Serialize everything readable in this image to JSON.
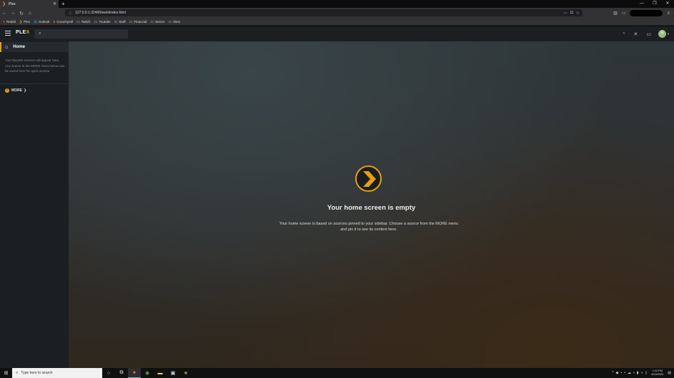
{
  "browser": {
    "tab_title": "Plex",
    "url": "127.0.0.1:32400/web/index.html",
    "bookmarks": [
      {
        "label": "Reddit",
        "icon": "reddit-icon"
      },
      {
        "label": "Plex",
        "icon": "plex-icon"
      },
      {
        "label": "Outlook",
        "icon": "outlook-icon"
      },
      {
        "label": "Crunchyroll",
        "icon": "crunchyroll-icon"
      },
      {
        "label": "Twitch",
        "icon": "folder-icon"
      },
      {
        "label": "Youtube",
        "icon": "folder-icon"
      },
      {
        "label": "Stuff",
        "icon": "folder-icon"
      },
      {
        "label": "Financial",
        "icon": "folder-icon"
      },
      {
        "label": "Server",
        "icon": "folder-icon"
      },
      {
        "label": "Sites",
        "icon": "folder-icon"
      }
    ]
  },
  "plex": {
    "logo_main": "PLE",
    "logo_accent": "X",
    "avatar_initial": "R",
    "accent_color": "#e5a00d"
  },
  "sidebar": {
    "home_label": "Home",
    "hint": "Your favorite sources will appear here. Any source in the MORE menu below can be saved here for quick access.",
    "more_label": "MORE",
    "more_badge": "!"
  },
  "main": {
    "title": "Your home screen is empty",
    "description": "Your home screen is based on sources pinned to your sidebar. Choose a source from the MORE menu and pin it to see its content here."
  },
  "taskbar": {
    "search_placeholder": "Type here to search",
    "time": "1:12 PM",
    "date": "6/24/2020"
  }
}
